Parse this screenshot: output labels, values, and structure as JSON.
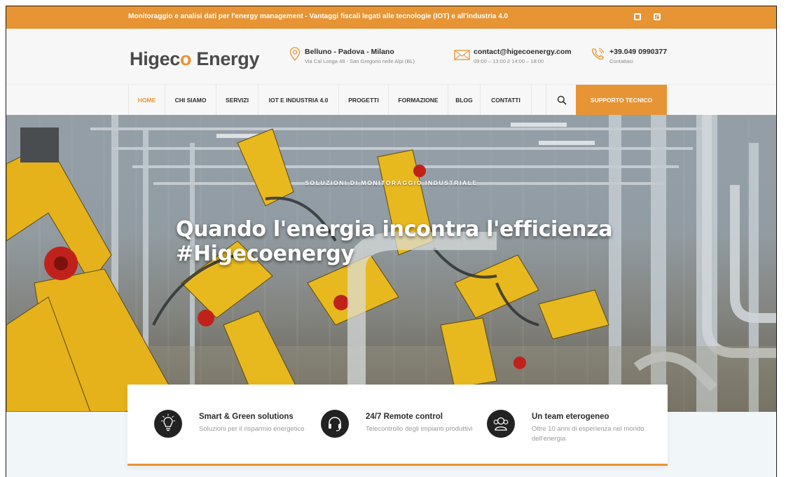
{
  "topbar": {
    "text": "Monitoraggio e analisi dati per l'energy management - Vantaggi fiscali legati alle tecnologie (IOT) e all'industria 4.0",
    "icons": [
      "facebook-icon",
      "instagram-icon"
    ]
  },
  "header": {
    "logo_main": "Higec",
    "logo_mark": "o",
    "logo_tail": " Energy",
    "location_title": "Belluno - Padova - Milano",
    "location_sub": "Via Cal Longa 48 - San Gregorio nelle Alpi (BL)",
    "email_title": "contact@higecoenergy.com",
    "email_sub": "09:00 – 13:00 // 14:00 – 18:00",
    "phone_title": "+39.049 0990377",
    "phone_sub": "Contattaci"
  },
  "nav": {
    "items": [
      {
        "label": "HOME",
        "active": true
      },
      {
        "label": "CHI SIAMO"
      },
      {
        "label": "SERVIZI"
      },
      {
        "label": "IOT E INDUSTRIA 4.0"
      },
      {
        "label": "PROGETTI"
      },
      {
        "label": "FORMAZIONE"
      },
      {
        "label": "BLOG"
      },
      {
        "label": "CONTATTI"
      }
    ],
    "support_label": "SUPPORTO TECNICO"
  },
  "hero": {
    "kicker": "SOLUZIONI DI MONITORAGGIO INDUSTRIALE",
    "title_line1": "Quando l'energia incontra l'efficienza",
    "title_line2": "#Higecoenergy"
  },
  "features": [
    {
      "icon": "lightbulb-icon",
      "title": "Smart & Green solutions",
      "desc": "Soluzioni per il risparmio energetico"
    },
    {
      "icon": "headset-icon",
      "title": "24/7 Remote control",
      "desc": "Telecontrollo degli impianti produttivi"
    },
    {
      "icon": "team-icon",
      "title": "Un team eterogeneo",
      "desc": "Oltre 10 anni di esperienza nel mondo dell'energia"
    }
  ],
  "colors": {
    "accent": "#e79434",
    "dark": "#222222",
    "text": "#2b2b2b"
  }
}
